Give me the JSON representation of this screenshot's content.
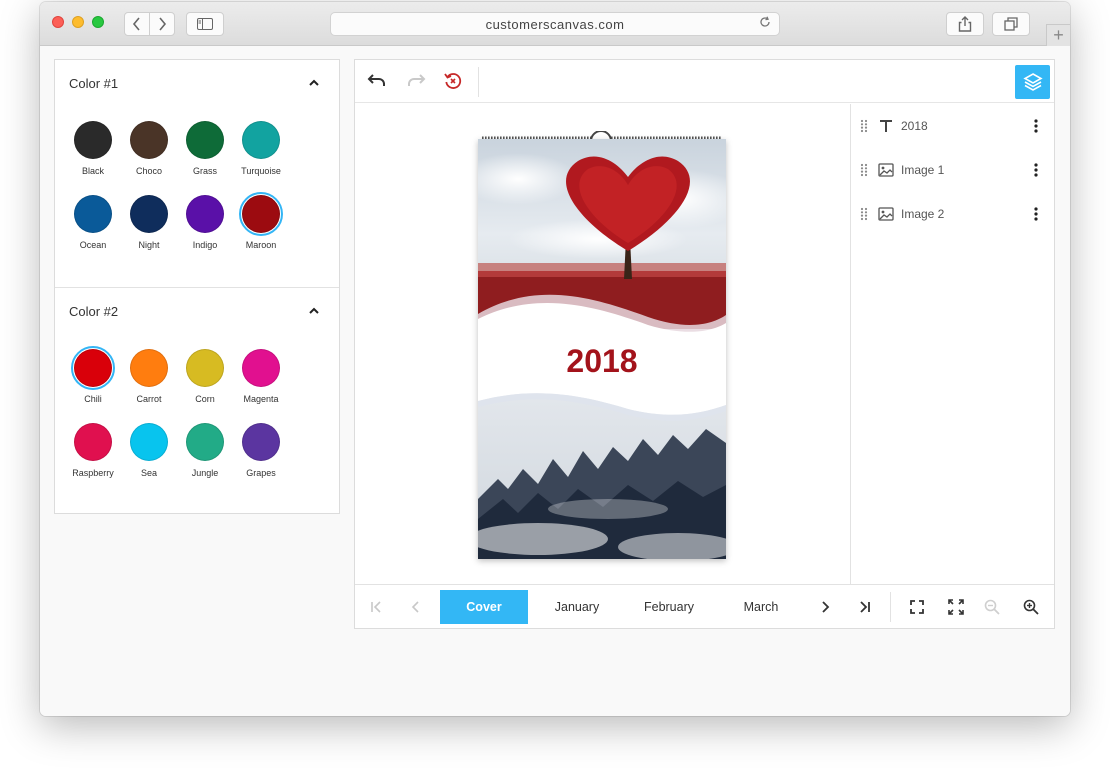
{
  "browser": {
    "url": "customerscanvas.com"
  },
  "color1": {
    "title": "Color #1",
    "swatches": [
      {
        "label": "Black",
        "color": "#2a2a2a",
        "selected": false
      },
      {
        "label": "Choco",
        "color": "#4a3427",
        "selected": false
      },
      {
        "label": "Grass",
        "color": "#0e6b38",
        "selected": false
      },
      {
        "label": "Turquoise",
        "color": "#12a3a0",
        "selected": false
      },
      {
        "label": "Ocean",
        "color": "#0a5a99",
        "selected": false
      },
      {
        "label": "Night",
        "color": "#0f2d5c",
        "selected": false
      },
      {
        "label": "Indigo",
        "color": "#5a10a8",
        "selected": false
      },
      {
        "label": "Maroon",
        "color": "#9c0b10",
        "selected": true
      }
    ]
  },
  "color2": {
    "title": "Color #2",
    "swatches": [
      {
        "label": "Chili",
        "color": "#d9000a",
        "selected": true
      },
      {
        "label": "Carrot",
        "color": "#ff7d0f",
        "selected": false
      },
      {
        "label": "Corn",
        "color": "#d7bb22",
        "selected": false
      },
      {
        "label": "Magenta",
        "color": "#e1108f",
        "selected": false
      },
      {
        "label": "Raspberry",
        "color": "#e0104f",
        "selected": false
      },
      {
        "label": "Sea",
        "color": "#08c4ee",
        "selected": false
      },
      {
        "label": "Jungle",
        "color": "#22ab87",
        "selected": false
      },
      {
        "label": "Grapes",
        "color": "#5b35a0",
        "selected": false
      }
    ]
  },
  "canvas": {
    "year_text": "2018"
  },
  "layers": [
    {
      "label": "2018",
      "icon": "text-icon"
    },
    {
      "label": "Image 1",
      "icon": "image-icon"
    },
    {
      "label": "Image 2",
      "icon": "image-icon"
    }
  ],
  "pager": {
    "tabs": [
      "Cover",
      "January",
      "February",
      "March"
    ],
    "active": "Cover"
  },
  "colors": {
    "accent": "#33b7f5",
    "year_red": "#a3131b"
  }
}
